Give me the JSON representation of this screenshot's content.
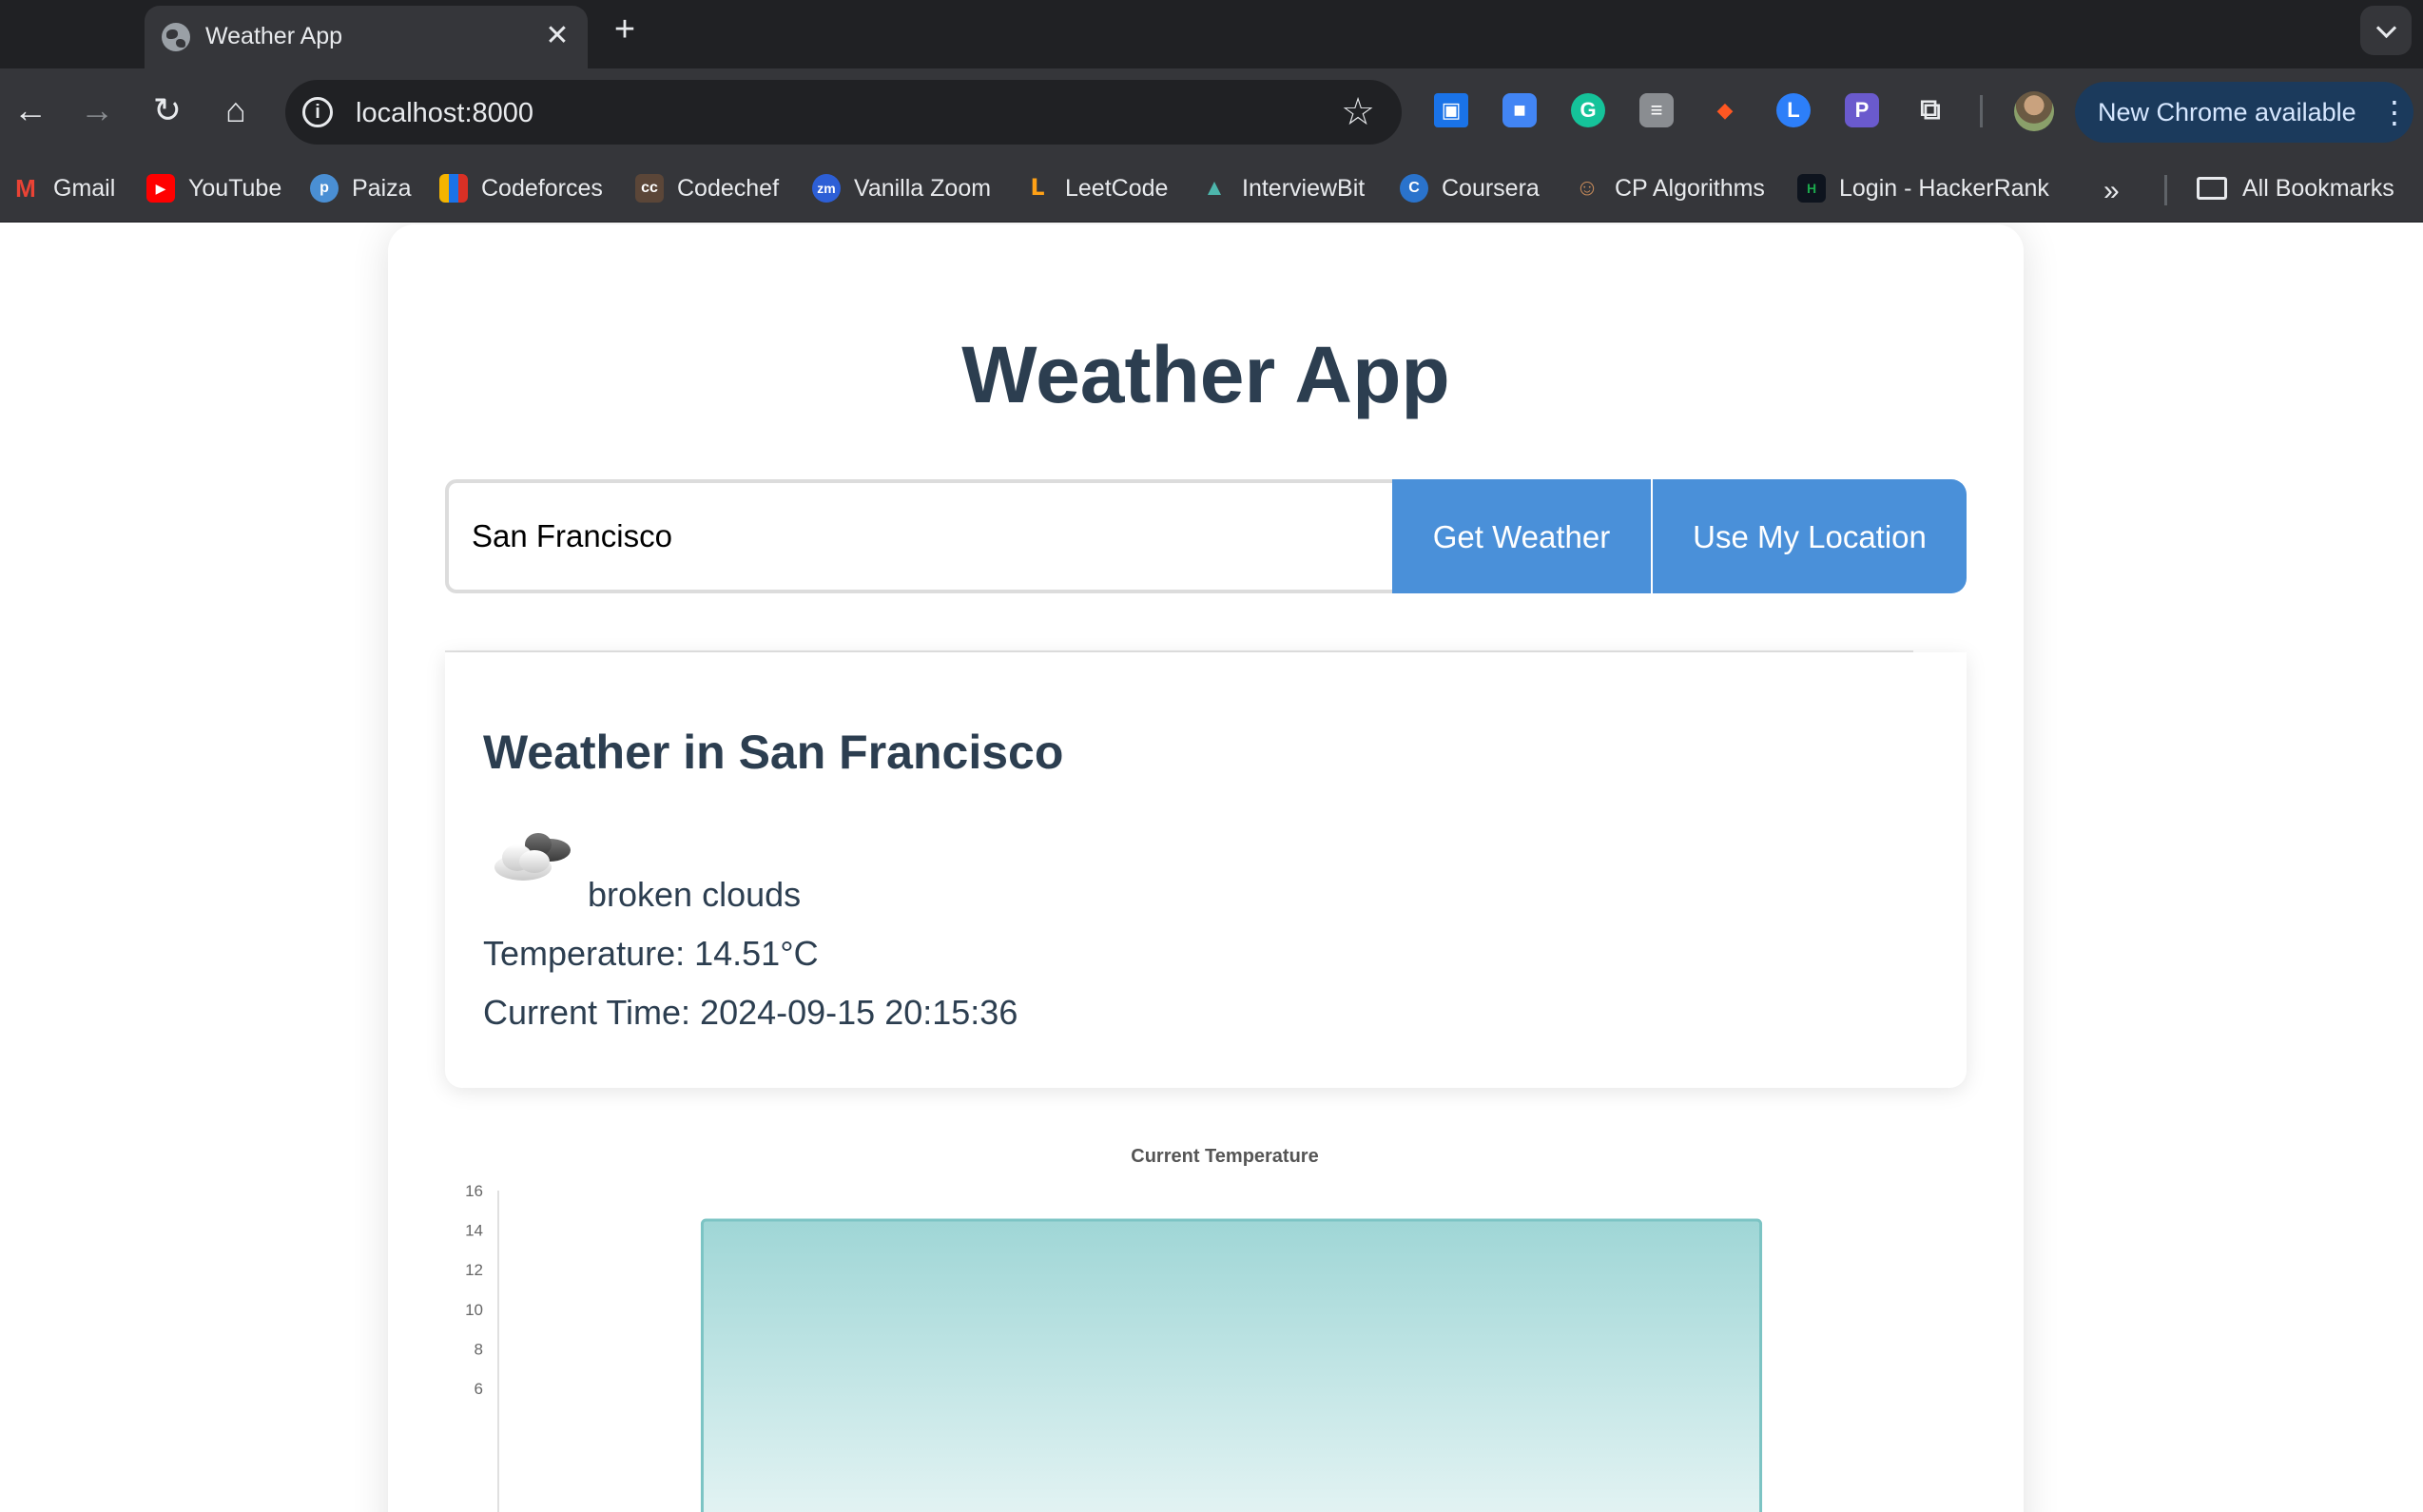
{
  "browser": {
    "tab_title": "Weather App",
    "url": "localhost:8000",
    "update_chip": "New Chrome available",
    "bookmarks": [
      {
        "label": "Gmail",
        "icon": "gmail-icon",
        "color": "#ea4335"
      },
      {
        "label": "YouTube",
        "icon": "youtube-icon",
        "color": "#ff0000"
      },
      {
        "label": "Paiza",
        "icon": "paiza-icon",
        "color": "#4a8fd4"
      },
      {
        "label": "Codeforces",
        "icon": "codeforces-icon",
        "color": "#f4b400"
      },
      {
        "label": "Codechef",
        "icon": "codechef-icon",
        "color": "#5b4638"
      },
      {
        "label": "Vanilla Zoom",
        "icon": "zoom-icon",
        "color": "#2d5fd6"
      },
      {
        "label": "LeetCode",
        "icon": "leetcode-icon",
        "color": "#ffa116"
      },
      {
        "label": "InterviewBit",
        "icon": "interviewbit-icon",
        "color": "#4db6ac"
      },
      {
        "label": "Coursera",
        "icon": "coursera-icon",
        "color": "#2a73cc"
      },
      {
        "label": "CP Algorithms",
        "icon": "cp-algorithms-icon",
        "color": "#a0522d"
      },
      {
        "label": "Login - HackerRank",
        "icon": "hackerrank-icon",
        "color": "#1ba94c"
      }
    ],
    "all_bookmarks": "All Bookmarks"
  },
  "app": {
    "title": "Weather App",
    "search_value": "San Francisco",
    "get_weather_label": "Get Weather",
    "use_location_label": "Use My Location",
    "accent": "#4a90d9"
  },
  "weather": {
    "heading": "Weather in San Francisco",
    "icon": "broken-clouds-icon",
    "description": "broken clouds",
    "temperature": "Temperature: 14.51°C",
    "time": "Current Time: 2024-09-15 20:15:36"
  },
  "chart_data": {
    "type": "bar",
    "title": "Current Temperature",
    "categories": [
      ""
    ],
    "values": [
      14.51
    ],
    "ylim": [
      0,
      16
    ],
    "yticks": [
      "16",
      "14",
      "12",
      "10",
      "8",
      "6"
    ],
    "bar_color": "#9fd6d6",
    "legend": "none"
  }
}
